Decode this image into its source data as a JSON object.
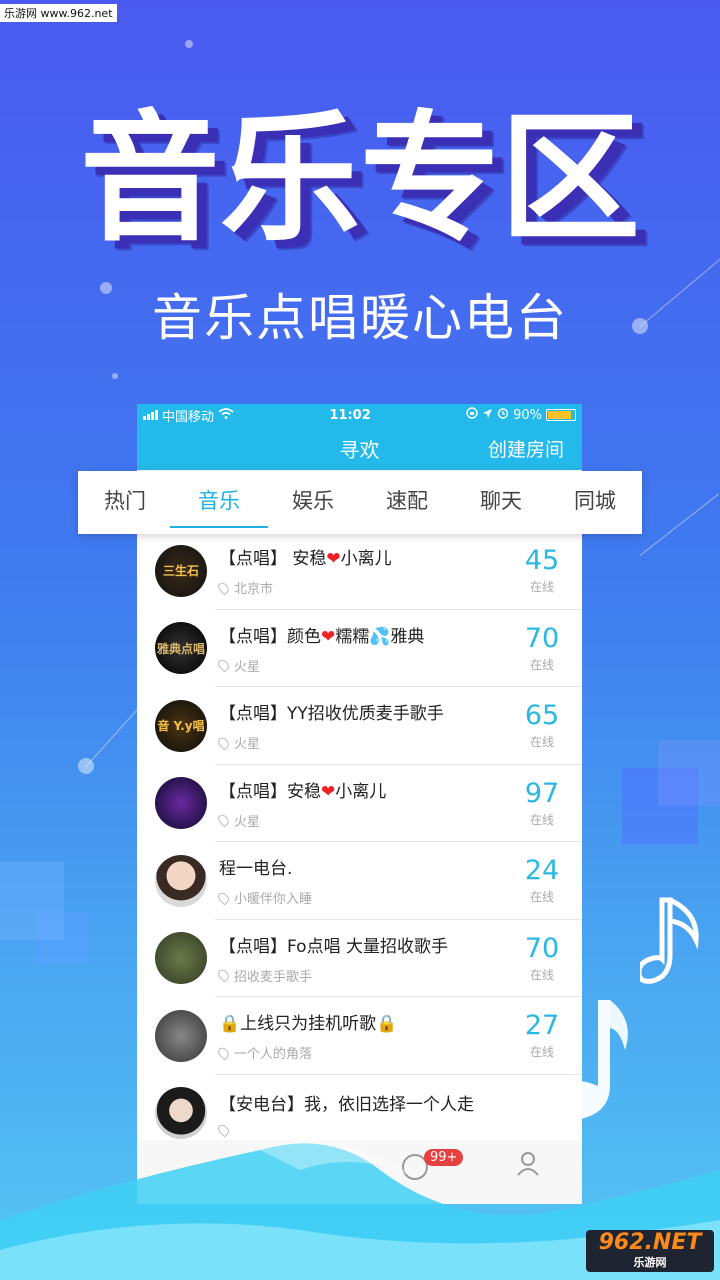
{
  "watermark": "乐游网 www.962.net",
  "hero": {
    "title": "音乐专区",
    "subtitle": "音乐点唱暖心电台"
  },
  "status_bar": {
    "carrier": "中国移动",
    "time": "11:02",
    "battery": "90%"
  },
  "app_bar": {
    "title": "寻欢",
    "create_label": "创建房间"
  },
  "tabs": [
    {
      "label": "热门"
    },
    {
      "label": "音乐"
    },
    {
      "label": "娱乐"
    },
    {
      "label": "速配"
    },
    {
      "label": "聊天"
    },
    {
      "label": "同城"
    }
  ],
  "active_tab": "音乐",
  "rooms": [
    {
      "title_a": "【点唱】 安稳",
      "title_b": "小离儿",
      "location": "北京市",
      "count": "45",
      "count_label": "在线"
    },
    {
      "title_a": "【点唱】颜色",
      "title_b": "糯糯",
      "title_c": "雅典",
      "location": "火星",
      "count": "70",
      "count_label": "在线"
    },
    {
      "title_a": "【点唱】YY招收优质麦手歌手",
      "location": "火星",
      "count": "65",
      "count_label": "在线"
    },
    {
      "title_a": "【点唱】安稳",
      "title_b": "小离儿",
      "location": "火星",
      "count": "97",
      "count_label": "在线"
    },
    {
      "title_a": "程一电台.",
      "location": "小暖伴你入睡",
      "count": "24",
      "count_label": "在线"
    },
    {
      "title_a": "【点唱】Fo点唱 大量招收歌手",
      "location": "招收麦手歌手",
      "count": "70",
      "count_label": "在线"
    },
    {
      "title_a": "上线只为挂机听歌",
      "location": "一个人的角落",
      "count": "27",
      "count_label": "在线"
    },
    {
      "title_a": "【安电台】我，依旧选择一个人走",
      "location": "",
      "count": "",
      "count_label": ""
    }
  ],
  "bottom_nav": {
    "badge": "99+"
  },
  "avatar_texts": {
    "a1": "三生石",
    "a2": "雅典点唱",
    "a3": "音 Y.y唱"
  },
  "logo": {
    "big": "962.NET",
    "small": "乐游网"
  },
  "colors": {
    "accent": "#1fb0e4",
    "count": "#2ab8e3",
    "header": "#23b9ea",
    "badge": "#e74040"
  }
}
